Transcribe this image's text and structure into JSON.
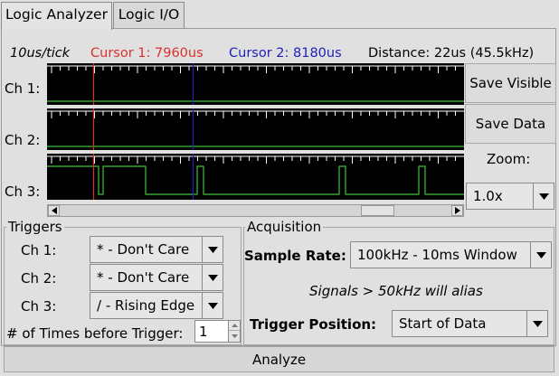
{
  "tabs": [
    {
      "label": "Logic Analyzer"
    },
    {
      "label": "Logic I/O"
    }
  ],
  "header": {
    "scale": "10us/tick",
    "cursor1": "Cursor 1: 7960us",
    "cursor2": "Cursor 2: 8180us",
    "distance": "Distance: 22us (45.5kHz)"
  },
  "colors": {
    "cursor1": "#d9302a",
    "cursor2": "#2020c0",
    "signal": "#40c040",
    "tick": "#ffffff",
    "trace_bg": "#000000"
  },
  "channels": [
    {
      "label": "Ch 1:",
      "level": "low"
    },
    {
      "label": "Ch 2:",
      "level": "low"
    },
    {
      "label": "Ch 3:",
      "level": "toggling"
    }
  ],
  "side": {
    "save_visible": "Save Visible",
    "save_data": "Save Data",
    "zoom_label": "Zoom:",
    "zoom_value": "1.0x"
  },
  "triggers": {
    "title": "Triggers",
    "rows": [
      {
        "label": "Ch 1:",
        "value": "* - Don't Care"
      },
      {
        "label": "Ch 2:",
        "value": "* - Don't Care"
      },
      {
        "label": "Ch 3:",
        "value": "/ - Rising Edge"
      }
    ],
    "times_label": "# of Times before Trigger:",
    "times_value": "1"
  },
  "acquisition": {
    "title": "Acquisition",
    "sample_rate_label": "Sample Rate:",
    "sample_rate_value": "100kHz - 10ms Window",
    "alias_note": "Signals > 50kHz will alias",
    "trigger_position_label": "Trigger Position:",
    "trigger_position_value": "Start of Data"
  },
  "analyze_button": "Analyze"
}
